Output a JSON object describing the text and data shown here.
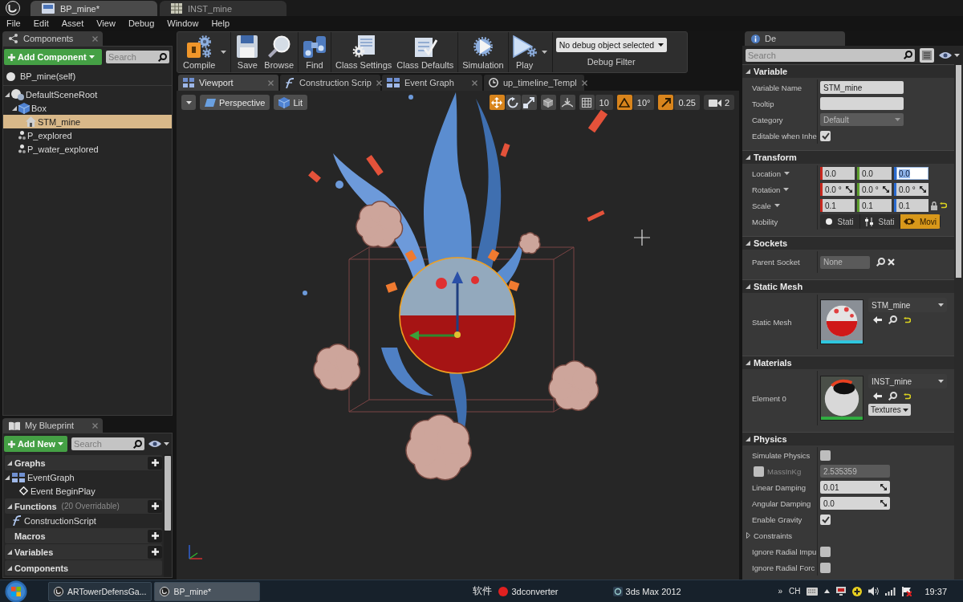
{
  "title_bar": {
    "tabs": [
      {
        "label": "BP_mine*",
        "kind": "blueprint",
        "selected": true
      },
      {
        "label": "INST_mine",
        "kind": "material",
        "selected": false
      }
    ]
  },
  "menu": [
    "File",
    "Edit",
    "Asset",
    "View",
    "Debug",
    "Window",
    "Help"
  ],
  "components_panel": {
    "title": "Components",
    "add_button": "Add Component",
    "search": {
      "placeholder": "Search"
    },
    "self_item": {
      "label": "BP_mine(self)",
      "selected": false
    },
    "tree": [
      {
        "label": "DefaultSceneRoot",
        "kind": "scene_root",
        "selected": false,
        "expanded": true,
        "children": [
          {
            "label": "Box",
            "kind": "box",
            "selected": false,
            "expanded": true,
            "children": [
              {
                "label": "STM_mine",
                "kind": "static_mesh",
                "selected": true
              }
            ]
          },
          {
            "label": "P_explored",
            "kind": "particles",
            "selected": false
          },
          {
            "label": "P_water_explored",
            "kind": "particles",
            "selected": false
          }
        ]
      }
    ]
  },
  "my_blueprint": {
    "title": "My Blueprint",
    "add_button": "Add New",
    "search": {
      "placeholder": "Search"
    },
    "sections": [
      {
        "title": "Graphs",
        "expanded": true,
        "addable": true,
        "items": [
          {
            "label": "EventGraph",
            "kind": "graph",
            "selected": false,
            "expanded": true,
            "children": [
              {
                "label": "Event BeginPlay",
                "kind": "event",
                "selected": false
              }
            ]
          }
        ]
      },
      {
        "title": "Functions",
        "note": "(20 Overridable)",
        "expanded": true,
        "addable": true,
        "items": [
          {
            "label": "ConstructionScript",
            "kind": "function",
            "selected": false
          }
        ]
      },
      {
        "title": "Macros",
        "addable": true
      },
      {
        "title": "Variables",
        "expanded": true,
        "addable": true
      },
      {
        "title": "Components",
        "expanded": true,
        "addable": false
      }
    ]
  },
  "toolbar": {
    "groups": [
      [
        {
          "label": "Compile",
          "kind": "compile",
          "dropdown": true
        }
      ],
      [
        {
          "label": "Save",
          "kind": "save",
          "dropdown": false
        },
        {
          "label": "Browse",
          "kind": "browse",
          "dropdown": false
        }
      ],
      [
        {
          "label": "Find",
          "kind": "find",
          "dropdown": false
        }
      ],
      [
        {
          "label": "Class Settings",
          "kind": "class_settings",
          "dropdown": false
        },
        {
          "label": "Class Defaults",
          "kind": "class_defaults",
          "dropdown": false
        }
      ],
      [
        {
          "label": "Simulation",
          "kind": "simulation",
          "dropdown": false
        }
      ],
      [
        {
          "label": "Play",
          "kind": "play",
          "dropdown": true
        }
      ]
    ],
    "debug_filter": {
      "value": "No debug object selected",
      "label": "Debug Filter"
    }
  },
  "editor_tabs": [
    {
      "label": "Viewport",
      "kind": "viewport",
      "selected": true
    },
    {
      "label": "Construction Scrip",
      "kind": "function",
      "selected": false
    },
    {
      "label": "Event Graph",
      "kind": "graph",
      "selected": false
    },
    {
      "label": "up_timeline_Templ",
      "kind": "timeline",
      "selected": false
    }
  ],
  "viewport": {
    "view_mode": "Perspective",
    "lighting": "Lit",
    "transform_tools": [
      {
        "kind": "translate",
        "selected": true
      },
      {
        "kind": "rotate",
        "selected": false
      },
      {
        "kind": "scale",
        "selected": false
      }
    ],
    "snaps": [
      {
        "kind": "grid",
        "on": false,
        "value": "10"
      },
      {
        "kind": "rotation",
        "on": true,
        "value": "10°"
      },
      {
        "kind": "scale",
        "on": true,
        "value": "0.25"
      }
    ],
    "camera_speed": "2"
  },
  "details": {
    "title": "De",
    "search": {
      "placeholder": "Search"
    },
    "sections": [
      {
        "title": "Variable",
        "expanded": true,
        "rows": [
          {
            "kind": "text",
            "label": "Variable Name",
            "value": "STM_mine"
          },
          {
            "kind": "text",
            "label": "Tooltip"
          },
          {
            "kind": "dropdown",
            "label": "Category",
            "value": "Default",
            "disabled": true
          },
          {
            "kind": "checkbox",
            "label": "Editable when Inhe",
            "checked": true
          }
        ]
      },
      {
        "title": "Transform",
        "expanded": true,
        "rows": [
          {
            "kind": "vector",
            "label": "Location",
            "values": [
              {
                "text": "0.0",
                "focused": false
              },
              {
                "text": "0.0",
                "focused": false
              },
              {
                "text": "0.0",
                "focused": true
              }
            ]
          },
          {
            "kind": "rotator",
            "label": "Rotation",
            "values": [
              {
                "text": "0.0 °",
                "focused": false
              },
              {
                "text": "0.0 °",
                "focused": false
              },
              {
                "text": "0.0 °",
                "focused": false
              }
            ]
          },
          {
            "kind": "scale",
            "label": "Scale",
            "values": [
              {
                "text": "0.1",
                "focused": false
              },
              {
                "text": "0.1",
                "focused": false
              },
              {
                "text": "0.1",
                "focused": false
              }
            ]
          },
          {
            "kind": "segmented",
            "label": "Mobility",
            "options": [
              {
                "label": "Stati",
                "kind": "static",
                "selected": false
              },
              {
                "label": "Stati",
                "kind": "stationary",
                "selected": false
              },
              {
                "label": "Movi",
                "kind": "movable",
                "selected": true
              }
            ]
          }
        ]
      },
      {
        "title": "Sockets",
        "expanded": true,
        "rows": [
          {
            "kind": "socket",
            "label": "Parent Socket",
            "value": "None"
          }
        ]
      },
      {
        "title": "Static Mesh",
        "expanded": true,
        "rows": [
          {
            "kind": "mesh_asset",
            "label": "Static Mesh",
            "value": "STM_mine"
          }
        ]
      },
      {
        "title": "Materials",
        "expanded": true,
        "rows": [
          {
            "kind": "material_asset",
            "label": "Element 0",
            "value": "INST_mine",
            "extra_button": "Textures"
          }
        ]
      },
      {
        "title": "Physics",
        "expanded": true,
        "rows": [
          {
            "kind": "checkbox",
            "label": "Simulate Physics",
            "checked": false
          },
          {
            "kind": "override_number",
            "label": "MassInKg",
            "checked": false,
            "disabled": true,
            "value": "2.535359"
          },
          {
            "kind": "number",
            "label": "Linear Damping",
            "value": "0.01",
            "disabled": false
          },
          {
            "kind": "number",
            "label": "Angular Damping",
            "value": "0.0",
            "disabled": false
          },
          {
            "kind": "checkbox",
            "label": "Enable Gravity",
            "checked": true
          },
          {
            "kind": "group",
            "label": "Constraints",
            "expanded": false
          },
          {
            "kind": "checkbox",
            "label": "Ignore Radial Impu",
            "checked": false
          },
          {
            "kind": "checkbox",
            "label": "Ignore Radial Forc",
            "checked": false
          }
        ]
      }
    ]
  },
  "taskbar": {
    "tasks": [
      {
        "label": "ARTowerDefensGa...",
        "selected": false
      },
      {
        "label": "BP_mine*",
        "selected": true
      }
    ],
    "toolbar_label": "软件",
    "apps": [
      {
        "label": "3dconverter",
        "kind": "recorder"
      },
      {
        "label": "3ds Max 2012",
        "kind": "max"
      }
    ],
    "tray": {
      "overflow": "»",
      "language": "CH",
      "clock": "19:37"
    }
  }
}
